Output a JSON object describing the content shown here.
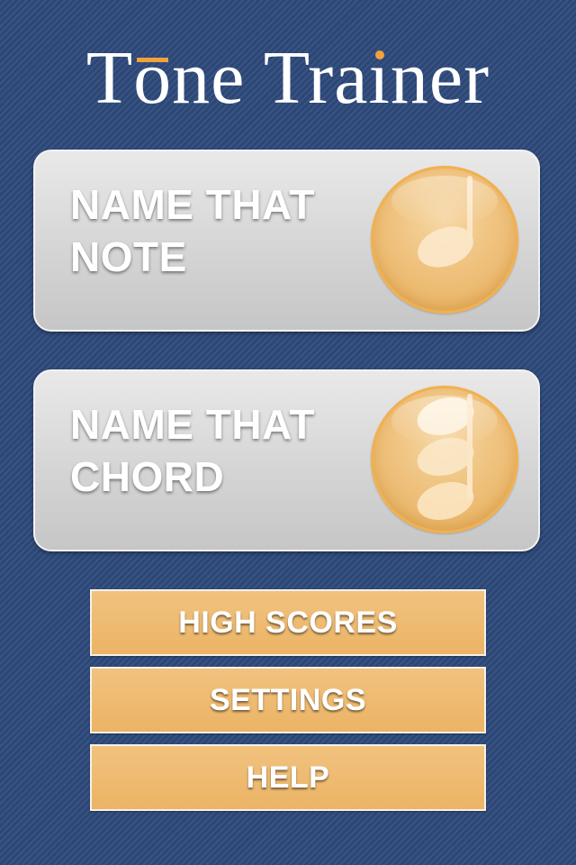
{
  "app": {
    "title_part1": "T",
    "title_o": "o",
    "title_part2": "ne Tra",
    "title_i": "ı",
    "title_part3": "ner"
  },
  "modes": [
    {
      "line1": "NAME THAT",
      "line2": "NOTE",
      "icon": "quarter-note-icon"
    },
    {
      "line1": "NAME THAT",
      "line2": "CHORD",
      "icon": "chord-icon"
    }
  ],
  "menu": {
    "high_scores": "HIGH SCORES",
    "settings": "SETTINGS",
    "help": "HELP"
  },
  "colors": {
    "background": "#2e4a7c",
    "accent": "#f0a33a",
    "button": "#ebb465"
  }
}
